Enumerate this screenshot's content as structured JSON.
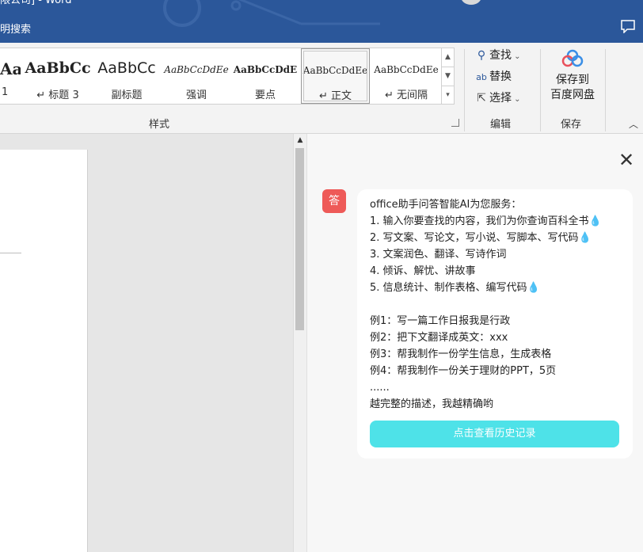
{
  "titlebar": {
    "title_fragment": "限公司]  - Word",
    "search_label": "明搜索",
    "bg_color": "#2b579a"
  },
  "ribbon": {
    "styles": [
      {
        "preview": "AaBbC",
        "name": "1"
      },
      {
        "preview": "AaBbCc",
        "name": "↵ 标题 3"
      },
      {
        "preview": "AaBbCc",
        "name": "副标题"
      },
      {
        "preview": "AaBbCcDdEe",
        "name": "强调"
      },
      {
        "preview": "AaBbCcDdE",
        "name": "要点"
      },
      {
        "preview": "AaBbCcDdEe",
        "name": "↵ 正文"
      },
      {
        "preview": "AaBbCcDdEe",
        "name": "↵ 无间隔"
      }
    ],
    "styles_group_label": "样式",
    "editing": {
      "find_label": "查找",
      "replace_label": "替换",
      "select_label": "选择",
      "group_label": "编辑"
    },
    "save": {
      "button_line1": "保存到",
      "button_line2": "百度网盘",
      "group_label": "保存"
    }
  },
  "assistant": {
    "avatar_text": "答",
    "avatar_color": "#ee5a58",
    "lines": [
      "office助手问答智能AI为您服务：",
      "1. 输入你要查找的内容，我们为你查询百科全书💧",
      "2. 写文案、写论文，写小说、写脚本、写代码💧",
      "3. 文案润色、翻译、写诗作词",
      "4. 倾诉、解忧、讲故事",
      "5. 信息统计、制作表格、编写代码💧",
      "",
      "例1：写一篇工作日报我是行政",
      "例2：把下文翻译成英文：xxx",
      "例3：帮我制作一份学生信息，生成表格",
      "例4：帮我制作一份关于理财的PPT，5页",
      "......",
      "越完整的描述，我越精确哟"
    ],
    "history_button": "点击查看历史记录",
    "history_button_color": "#4ee2e8"
  },
  "icons": {
    "close": "close-icon",
    "find": "search-icon",
    "replace": "replace-icon",
    "select": "cursor-icon",
    "cloud": "baidu-cloud-icon",
    "comment": "comment-icon"
  }
}
